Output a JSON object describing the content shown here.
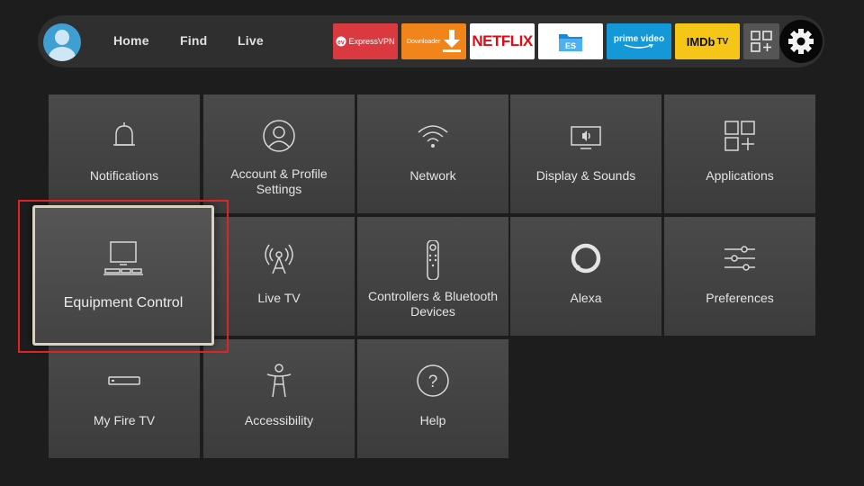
{
  "nav": {
    "items": [
      {
        "label": "Home"
      },
      {
        "label": "Find"
      },
      {
        "label": "Live"
      }
    ]
  },
  "apps": [
    {
      "label": "ExpressVPN",
      "color": "#da3940"
    },
    {
      "label": "Downloader",
      "color": "#f1841b"
    },
    {
      "label": "NETFLIX",
      "color": "#ffffff"
    },
    {
      "label": "ES",
      "color": "#ffffff"
    },
    {
      "label": "prime video",
      "color": "#1598d8"
    },
    {
      "label": "IMDb",
      "label_suffix": "TV",
      "color": "#f5c518"
    }
  ],
  "icons": {
    "avatar": "user-avatar-icon",
    "all_apps": "all-apps-grid-icon",
    "settings": "gear-icon"
  },
  "tiles": [
    {
      "label": "Notifications",
      "icon": "bell-icon"
    },
    {
      "label": "Account & Profile Settings",
      "icon": "profile-icon"
    },
    {
      "label": "Network",
      "icon": "wifi-icon"
    },
    {
      "label": "Display & Sounds",
      "icon": "display-sound-icon"
    },
    {
      "label": "Applications",
      "icon": "apps-grid-icon"
    },
    {
      "label": "Equipment Control",
      "icon": "tv-equipment-icon",
      "focused": true
    },
    {
      "label": "Live TV",
      "icon": "antenna-icon"
    },
    {
      "label": "Controllers & Bluetooth Devices",
      "icon": "remote-icon"
    },
    {
      "label": "Alexa",
      "icon": "alexa-ring-icon"
    },
    {
      "label": "Preferences",
      "icon": "sliders-icon"
    },
    {
      "label": "My Fire TV",
      "icon": "fire-tv-stick-icon"
    },
    {
      "label": "Accessibility",
      "icon": "accessibility-person-icon"
    },
    {
      "label": "Help",
      "icon": "question-icon"
    }
  ],
  "colors": {
    "highlight": "#e02424",
    "background": "#1d1d1d",
    "tile": "#444444",
    "focus_border": "#d9d2c3"
  }
}
